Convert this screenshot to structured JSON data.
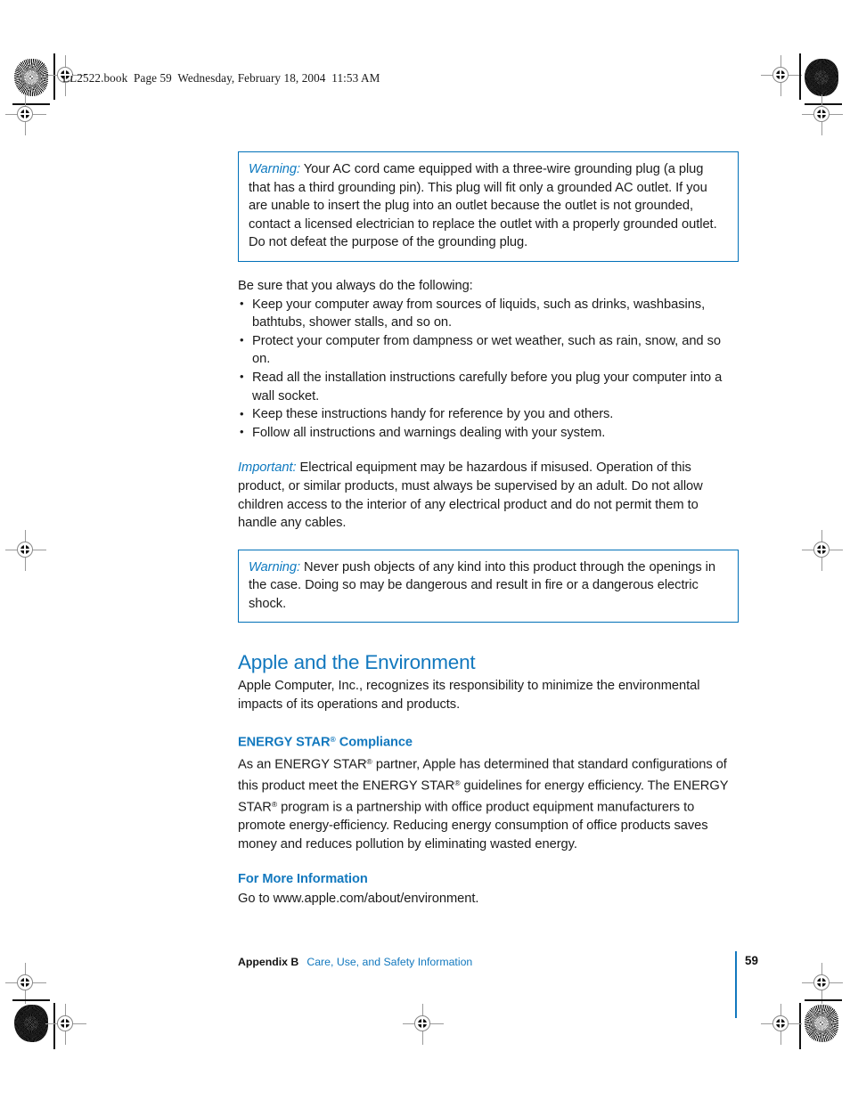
{
  "document": {
    "running_header": "LL2522.book  Page 59  Wednesday, February 18, 2004  11:53 AM",
    "page_number": "59"
  },
  "colors": {
    "accent_blue": "#1278be",
    "label_blue": "#0f7ac0",
    "box_border": "#0070b8",
    "body_text": "#1b1b1b"
  },
  "content": {
    "warning_1": {
      "label": "Warning:",
      "text": " Your AC cord came equipped with a three-wire grounding plug (a plug that has a third grounding pin). This plug will fit only a grounded AC outlet. If you are unable to insert the plug into an outlet because the outlet is not grounded, contact a licensed electrician to replace the outlet with a properly grounded outlet. Do not defeat the purpose of the grounding plug."
    },
    "bullet_intro": "Be sure that you always do the following:",
    "bullets": [
      "Keep your computer away from sources of liquids, such as drinks, washbasins, bathtubs, shower stalls, and so on.",
      "Protect your computer from dampness or wet weather, such as rain, snow, and so on.",
      "Read all the installation instructions carefully before you plug your computer into a wall socket.",
      "Keep these instructions handy for reference by you and others.",
      "Follow all instructions and warnings dealing with your system."
    ],
    "important": {
      "label": "Important:",
      "text": " Electrical equipment may be hazardous if misused. Operation of this product, or similar products, must always be supervised by an adult. Do not allow children access to the interior of any electrical product and do not permit them to handle any cables."
    },
    "warning_2": {
      "label": "Warning:",
      "text": " Never push objects of any kind into this product through the openings in the case. Doing so may be dangerous and result in fire or a dangerous electric shock."
    },
    "section": {
      "title": "Apple and the Environment",
      "body": "Apple Computer, Inc., recognizes its responsibility to minimize the environmental impacts of its operations and products."
    },
    "energy_star": {
      "heading_main": "ENERGY STAR",
      "heading_mark": "®",
      "heading_tail": " Compliance",
      "body_1": "As an ENERGY STAR",
      "body_2": " partner, Apple has determined that standard configurations of this product meet the ENERGY STAR",
      "body_3": " guidelines for energy efficiency. The ENERGY STAR",
      "body_4": " program is a partnership with office product equipment manufacturers to promote energy-efficiency. Reducing energy consumption of office products saves money and reduces pollution by eliminating wasted energy.",
      "mark": "®"
    },
    "more_info": {
      "heading": "For More Information",
      "body": "Go to www.apple.com/about/environment."
    }
  },
  "footer": {
    "appendix": "Appendix B",
    "chapter": "Care, Use, and Safety Information"
  }
}
